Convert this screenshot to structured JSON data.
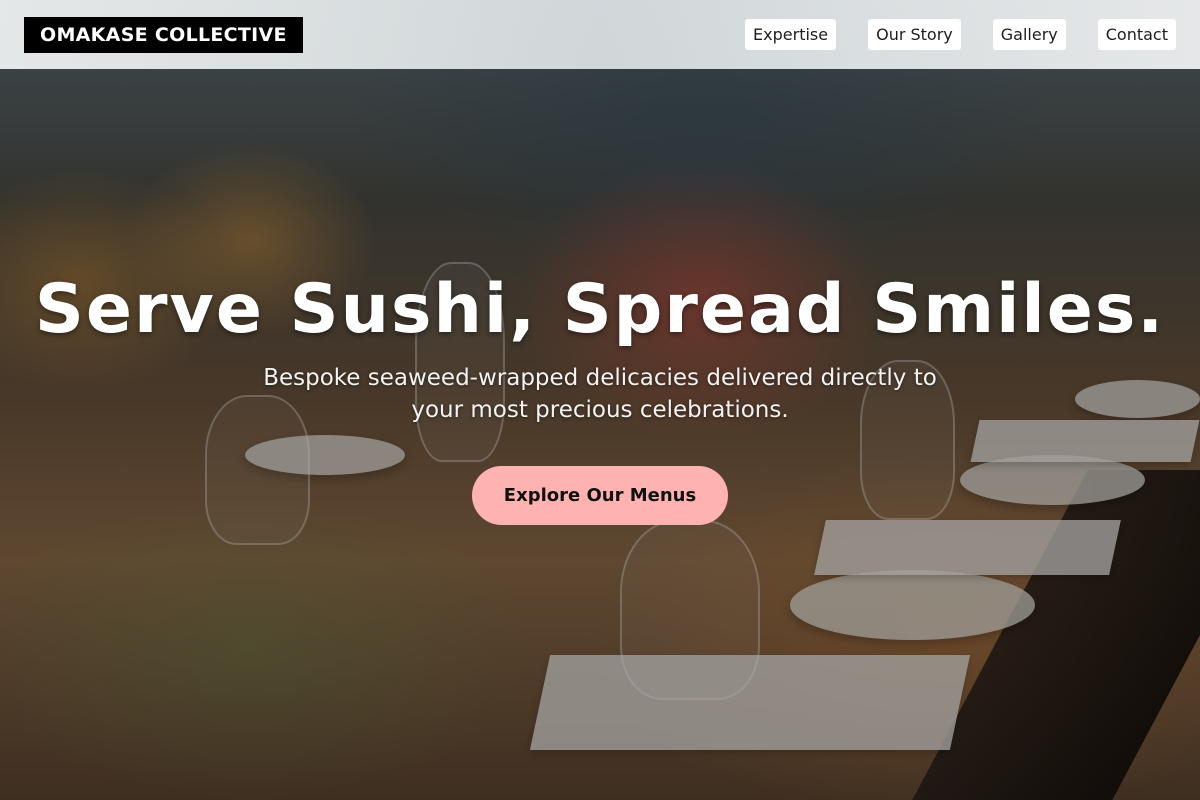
{
  "header": {
    "logo": "OMAKASE COLLECTIVE",
    "nav": [
      {
        "label": "Expertise"
      },
      {
        "label": "Our Story"
      },
      {
        "label": "Gallery"
      },
      {
        "label": "Contact"
      }
    ]
  },
  "hero": {
    "headline": "Serve Sushi, Spread Smiles.",
    "subtext": "Bespoke seaweed-wrapped delicacies delivered directly to your most precious celebrations.",
    "cta_label": "Explore Our Menus",
    "cta_color": "#ffb3b0"
  }
}
